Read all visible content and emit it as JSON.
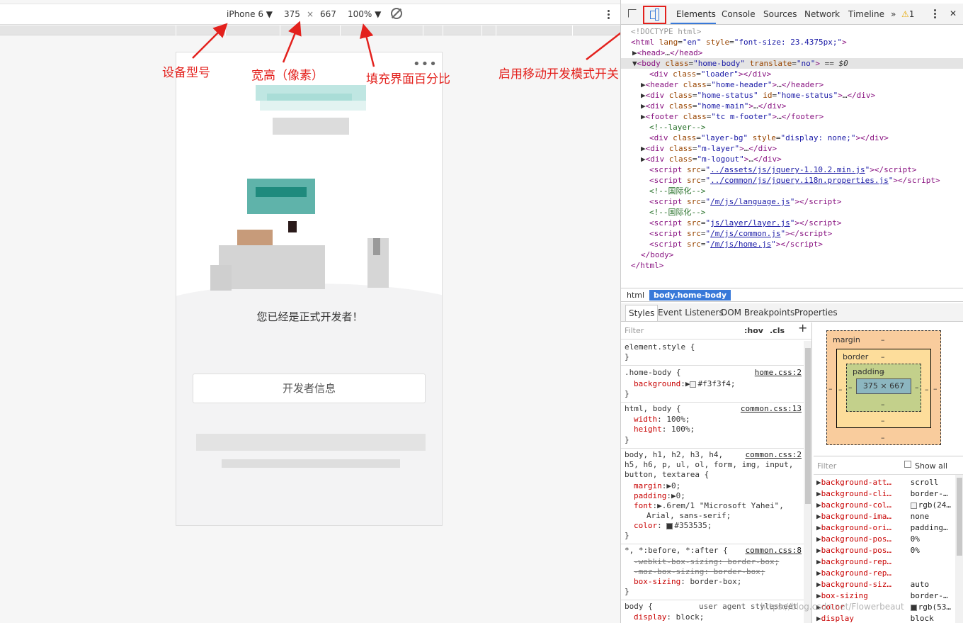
{
  "emulator": {
    "device": "iPhone 6 ▼",
    "width": "375",
    "times": "×",
    "height": "667",
    "zoom": "100% ▼"
  },
  "phone": {
    "dots": "•••",
    "message": "您已经是正式开发者！",
    "button_label": "开发者信息"
  },
  "annotations": {
    "device_model": "设备型号",
    "dimensions": "宽高（像素）",
    "zoom": "填充界面百分比",
    "mobile_mode": "启用移动开发模式开关"
  },
  "devtools": {
    "tabs": [
      "Elements",
      "Console",
      "Sources",
      "Network",
      "Timeline"
    ],
    "more": "»",
    "warnings": "1",
    "warn_icon": "⚠",
    "close": "✕",
    "crumbs": [
      "html",
      "body.home-body"
    ],
    "subtabs": [
      "Styles",
      "Event Listeners",
      "DOM Breakpoints",
      "Properties"
    ],
    "styles_filter": "Filter",
    "hov": ":hov",
    "cls": ".cls",
    "plus": "+",
    "computed_filter": "Filter",
    "show_all": "Show all",
    "box_model": {
      "margin": "margin",
      "border": "border",
      "padding": "padding",
      "content": "375 × 667",
      "dash": "–"
    },
    "computed": [
      {
        "prop": "background-att…",
        "val": "scroll"
      },
      {
        "prop": "background-cli…",
        "val": "border-…"
      },
      {
        "prop": "background-col…",
        "val": "rgb(24…"
      },
      {
        "prop": "background-ima…",
        "val": "none"
      },
      {
        "prop": "background-ori…",
        "val": "padding…"
      },
      {
        "prop": "background-pos…",
        "val": "0%"
      },
      {
        "prop": "background-pos…",
        "val": "0%"
      },
      {
        "prop": "background-rep…",
        "val": ""
      },
      {
        "prop": "background-rep…",
        "val": ""
      },
      {
        "prop": "background-siz…",
        "val": "auto"
      },
      {
        "prop": "box-sizing",
        "val": "border-…"
      },
      {
        "prop": "color",
        "val": "rgb(53…"
      },
      {
        "prop": "display",
        "val": "block"
      }
    ]
  },
  "watermark": "https://blog.csdn.net/Flowerbeaut"
}
